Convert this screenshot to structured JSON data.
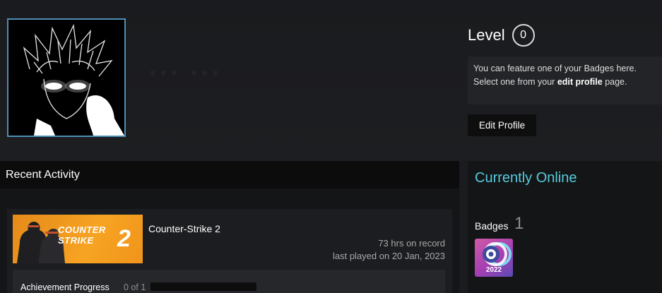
{
  "profile": {
    "level_label": "Level",
    "level_value": "0",
    "badge_note_line1": "You can feature one of your Badges here.",
    "badge_note_line2_prefix": "Select one from your ",
    "badge_note_line2_link": "edit profile",
    "badge_note_line2_suffix": " page.",
    "edit_profile_label": "Edit Profile"
  },
  "recent_activity": {
    "title": "Recent Activity",
    "game": {
      "name": "Counter-Strike 2",
      "logo_line1": "COUNTER",
      "logo_line2": "STRIKE",
      "logo_number": "2",
      "hours": "73 hrs on record",
      "last_played": "last played on 20 Jan, 2023",
      "achievement_label": "Achievement Progress",
      "achievement_count": "0 of 1",
      "achievement_progress": 0
    }
  },
  "sidebar": {
    "status": "Currently Online",
    "badges_label": "Badges",
    "badges_count": "1",
    "badge_year": "2022"
  },
  "colors": {
    "accent_blue": "#57cbde",
    "avatar_border": "#4f8fb5",
    "cs2_orange": "#f7a322"
  }
}
